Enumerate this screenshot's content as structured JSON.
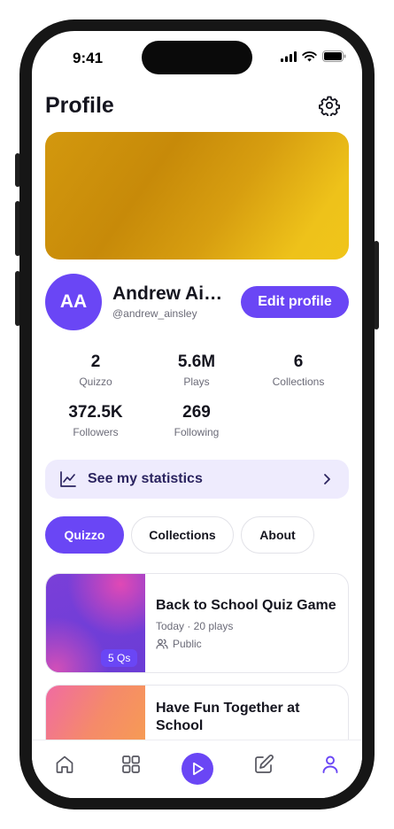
{
  "status": {
    "time": "9:41"
  },
  "header": {
    "title": "Profile"
  },
  "profile": {
    "initials": "AA",
    "name": "Andrew Ainsley",
    "handle": "@andrew_ainsley",
    "edit_label": "Edit profile"
  },
  "stats": [
    {
      "value": "2",
      "label": "Quizzo"
    },
    {
      "value": "5.6M",
      "label": "Plays"
    },
    {
      "value": "6",
      "label": "Collections"
    },
    {
      "value": "372.5K",
      "label": "Followers"
    },
    {
      "value": "269",
      "label": "Following"
    }
  ],
  "statistics_link": {
    "label": "See my statistics"
  },
  "tabs": [
    {
      "label": "Quizzo",
      "active": true
    },
    {
      "label": "Collections",
      "active": false
    },
    {
      "label": "About",
      "active": false
    }
  ],
  "quizzes": [
    {
      "title": "Back to School Quiz Game",
      "meta": "Today · 20 plays",
      "visibility": "Public",
      "questions": "5 Qs"
    },
    {
      "title": "Have Fun Together at School",
      "meta": "",
      "visibility": "",
      "questions": ""
    }
  ],
  "bottom_nav": [
    {
      "icon": "home-icon"
    },
    {
      "icon": "grid-icon"
    },
    {
      "icon": "play-icon"
    },
    {
      "icon": "edit-icon"
    },
    {
      "icon": "user-icon",
      "active": true
    }
  ],
  "colors": {
    "accent": "#6a46f5",
    "banner": "#d79e10",
    "stats_bg": "#eeebfd"
  }
}
